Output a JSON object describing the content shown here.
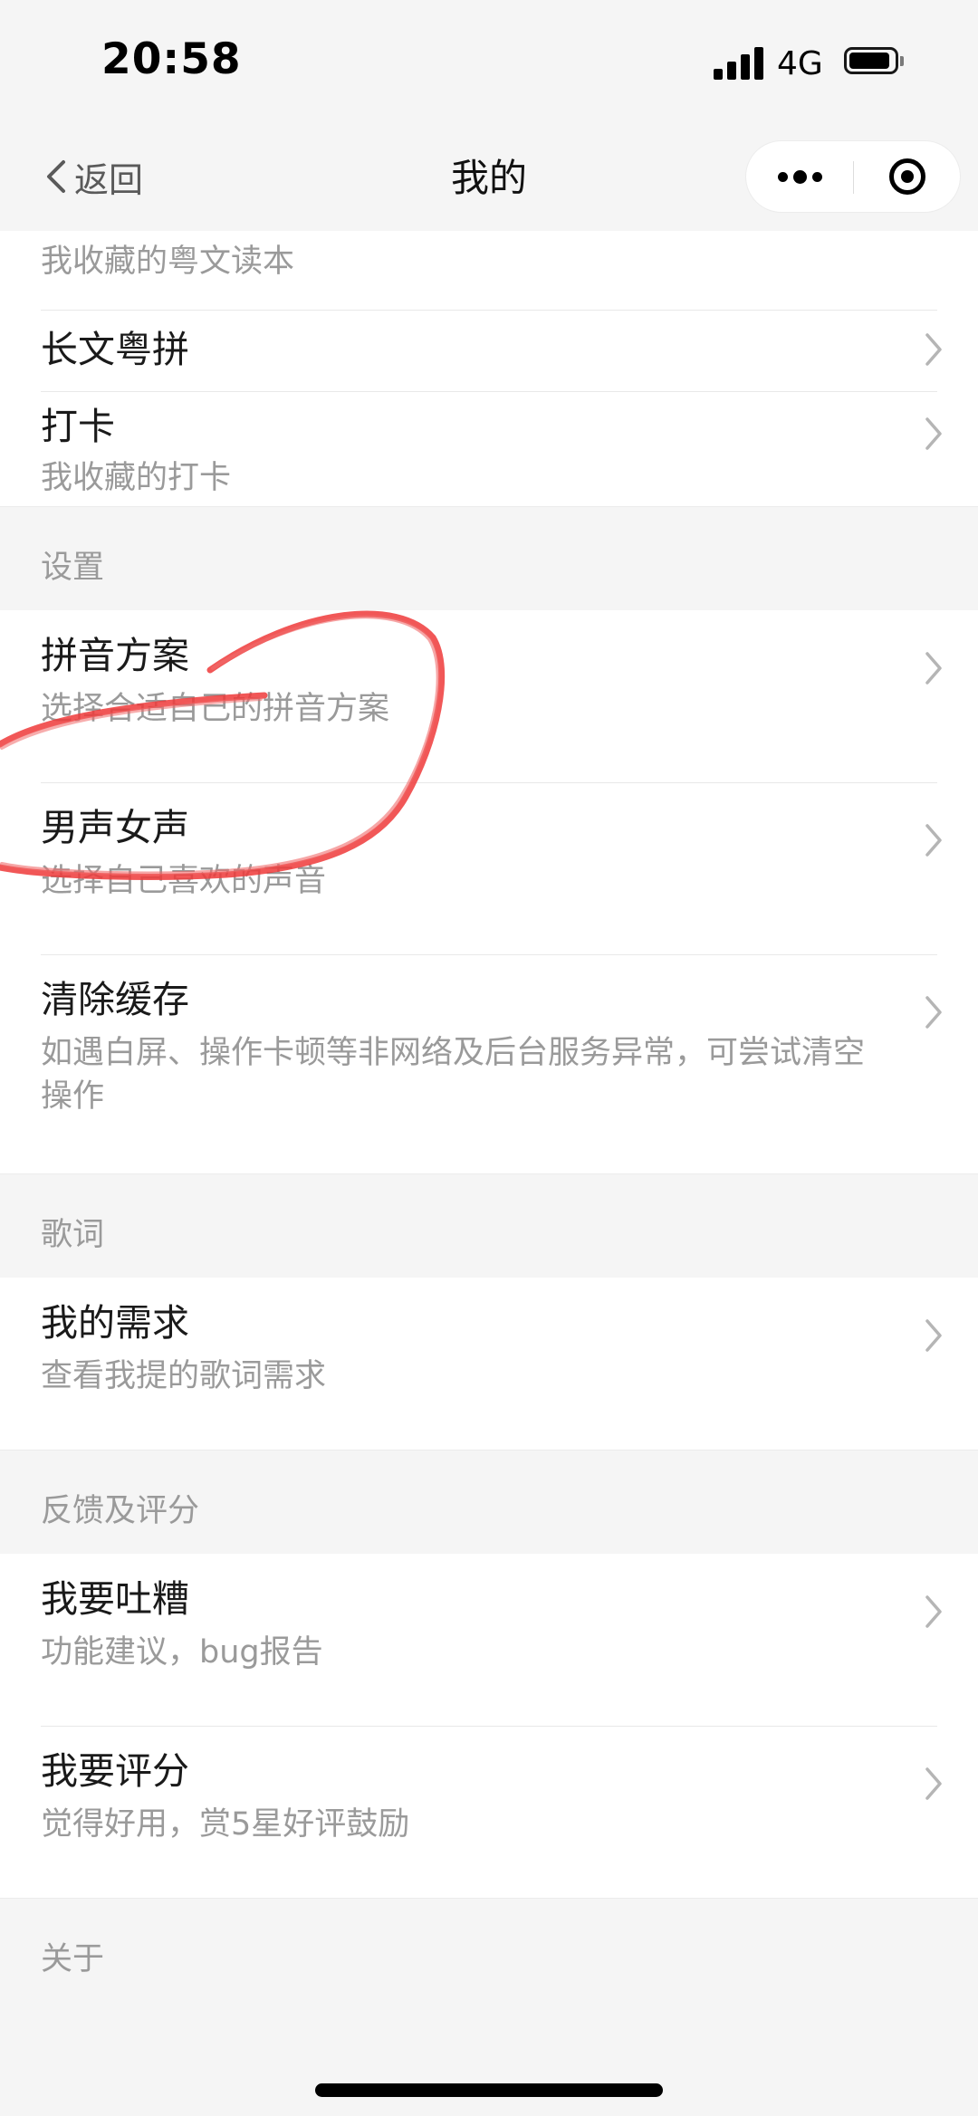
{
  "status_bar": {
    "time": "20:58",
    "network": "4G",
    "signal_icon": "signal-bars-icon",
    "battery_icon": "battery-icon"
  },
  "nav": {
    "back_label": "返回",
    "title": "我的",
    "more_icon": "more-dots-icon",
    "close_icon": "target-circle-icon"
  },
  "top_group": [
    {
      "title": "",
      "desc": "我收藏的粤文读本"
    },
    {
      "title": "长文粤拼",
      "desc": ""
    },
    {
      "title": "打卡",
      "desc": "我收藏的打卡"
    }
  ],
  "sections": [
    {
      "header": "设置",
      "items": [
        {
          "title": "拼音方案",
          "desc": "选择合适自己的拼音方案"
        },
        {
          "title": "男声女声",
          "desc": "选择自己喜欢的声音"
        },
        {
          "title": "清除缓存",
          "desc": "如遇白屏、操作卡顿等非网络及后台服务异常，可尝试清空操作"
        }
      ]
    },
    {
      "header": "歌词",
      "items": [
        {
          "title": "我的需求",
          "desc": "查看我提的歌词需求"
        }
      ]
    },
    {
      "header": "反馈及评分",
      "items": [
        {
          "title": "我要吐糟",
          "desc": "功能建议，bug报告"
        },
        {
          "title": "我要评分",
          "desc": "觉得好用，赏5星好评鼓励"
        }
      ]
    },
    {
      "header": "关于",
      "items": []
    }
  ],
  "colors": {
    "background": "#f5f5f5",
    "title_text": "#1a1a1a",
    "secondary_text": "#9a9a9a",
    "annotation_stroke": "#ee3a3a"
  }
}
